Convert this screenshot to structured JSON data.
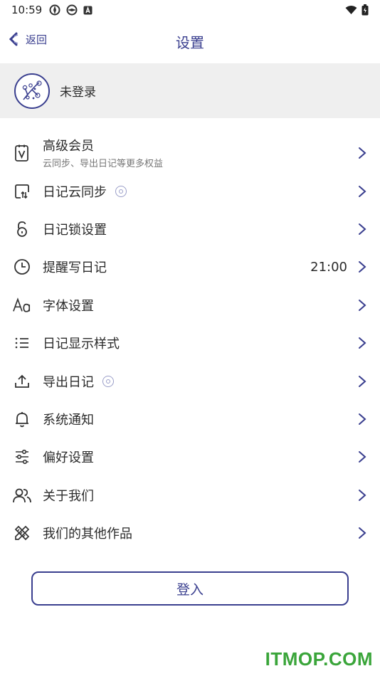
{
  "status_bar": {
    "time": "10:59"
  },
  "nav": {
    "back_label": "返回",
    "title": "设置"
  },
  "login_banner": {
    "label": "未登录"
  },
  "menu": [
    {
      "label": "高级会员",
      "sub": "云同步、导出日记等更多权益",
      "icon": "vip-card-icon"
    },
    {
      "label": "日记云同步",
      "vip": true,
      "icon": "cloud-sync-icon"
    },
    {
      "label": "日记锁设置",
      "icon": "lock-icon"
    },
    {
      "label": "提醒写日记",
      "value": "21:00",
      "icon": "clock-icon"
    },
    {
      "label": "字体设置",
      "icon": "font-icon"
    },
    {
      "label": "日记显示样式",
      "icon": "list-style-icon"
    },
    {
      "label": "导出日记",
      "vip": true,
      "icon": "export-icon"
    },
    {
      "label": "系统通知",
      "icon": "bell-icon"
    },
    {
      "label": "偏好设置",
      "icon": "sliders-icon"
    },
    {
      "label": "关于我们",
      "icon": "people-icon"
    },
    {
      "label": "我们的其他作品",
      "icon": "tools-icon"
    }
  ],
  "signin_button": {
    "label": "登入"
  },
  "watermark": "ITMOP.COM",
  "colors": {
    "accent": "#3a3f8f",
    "banner_bg": "#efefef",
    "watermark": "#3aa53a"
  }
}
